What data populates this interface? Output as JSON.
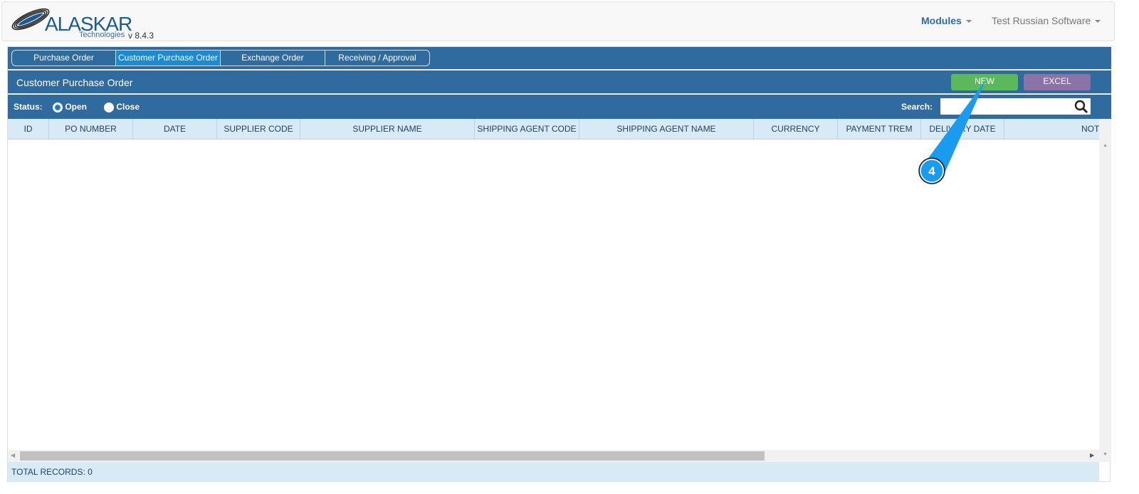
{
  "brand": {
    "name": "ALASKAR",
    "sub": "Technologies",
    "version": "v 8.4.3"
  },
  "nav": {
    "modules": "Modules",
    "user": "Test Russian Software"
  },
  "tabs": [
    {
      "label": "Purchase Order"
    },
    {
      "label": "Customer Purchase Order",
      "active": true
    },
    {
      "label": "Exchange Order"
    },
    {
      "label": "Receiving / Approval"
    }
  ],
  "page": {
    "title": "Customer Purchase Order",
    "new_label": "NEW",
    "excel_label": "EXCEL"
  },
  "filters": {
    "status_label": "Status:",
    "open_label": "Open",
    "close_label": "Close",
    "selected": "Open",
    "search_label": "Search:",
    "search_value": ""
  },
  "table": {
    "columns": [
      "ID",
      "PO NUMBER",
      "DATE",
      "SUPPLIER CODE",
      "SUPPLIER NAME",
      "SHIPPING AGENT CODE",
      "SHIPPING AGENT NAME",
      "CURRENCY",
      "PAYMENT TREM",
      "DELIVERY DATE",
      "NOTE"
    ],
    "rows": []
  },
  "footer": {
    "total": "TOTAL RECORDS: 0"
  },
  "annotation": {
    "step": "4"
  },
  "colors": {
    "header": "#2f6b9e",
    "new": "#5cb85c",
    "excel": "#8a73a6",
    "table_header": "#d9eaf7",
    "callout": "#1a9bf0"
  }
}
